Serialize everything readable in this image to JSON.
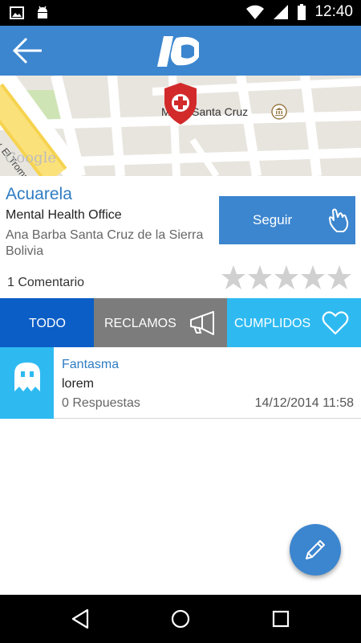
{
  "status_bar": {
    "time": "12:40",
    "left_icons": [
      "image-icon",
      "android-icon"
    ],
    "right_icons": [
      "wifi-icon",
      "signal-icon",
      "battery-icon"
    ]
  },
  "app_bar": {
    "back_icon": "arrow-left-icon",
    "logo_icon": "app-logo-icon",
    "color": "#3c86cf"
  },
  "map": {
    "street_label": "Av. El Trompillo",
    "place_label": "M  ion Santa Cruz",
    "watermark": "Google",
    "marker_icon": "hospital-marker-icon"
  },
  "place": {
    "name": "Acuarela",
    "type": "Mental Health Office",
    "address": "Ana Barba Santa Cruz de la Sierra Bolivia",
    "comments": "1 Comentario",
    "follow_label": "Seguir",
    "rating": 0,
    "rating_max": 5
  },
  "tabs": [
    {
      "label": "TODO",
      "color": "#0b5ec6"
    },
    {
      "label": "RECLAMOS",
      "color": "#7c7c7c",
      "icon": "megaphone-icon"
    },
    {
      "label": "CUMPLIDOS",
      "color": "#2ebaf1",
      "icon": "heart-icon"
    }
  ],
  "posts": [
    {
      "author": "Fantasma",
      "text": "lorem",
      "replies": "0 Respuestas",
      "date": "14/12/2014 11:58",
      "avatar_icon": "ghost-icon"
    }
  ],
  "fab": {
    "icon": "pencil-icon"
  },
  "nav_bar": {
    "icons": [
      "back-triangle-icon",
      "home-circle-icon",
      "recents-square-icon"
    ]
  }
}
